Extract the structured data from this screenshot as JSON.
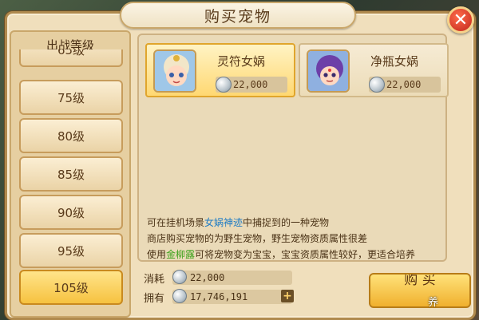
{
  "dialog": {
    "title": "购买宠物",
    "close_label": "✕"
  },
  "levels": {
    "header": "出战等级",
    "items": [
      "65级",
      "75级",
      "80级",
      "85级",
      "90级",
      "95级",
      "105级"
    ],
    "selected": "105级"
  },
  "pets": [
    {
      "name": "灵符女娲",
      "price": "22,000",
      "selected": true
    },
    {
      "name": "净瓶女娲",
      "price": "22,000",
      "selected": false
    }
  ],
  "description": {
    "line1_pre": "可在挂机场景",
    "line1_hl": "女娲神迹",
    "line1_post": "中捕捉到的一种宠物",
    "line2": "商店购买宠物的为野生宠物，野生宠物资质属性很差",
    "line3_pre": "使用",
    "line3_hl": "金柳露",
    "line3_post": "可将宠物变为宝宝，宝宝资质属性较好，更适合培养"
  },
  "cost": {
    "label": "消耗",
    "value": "22,000"
  },
  "owned": {
    "label": "拥有",
    "value": "17,746,191",
    "add_label": "+"
  },
  "buy_button": {
    "label": "购 买"
  },
  "watermark": "养"
}
